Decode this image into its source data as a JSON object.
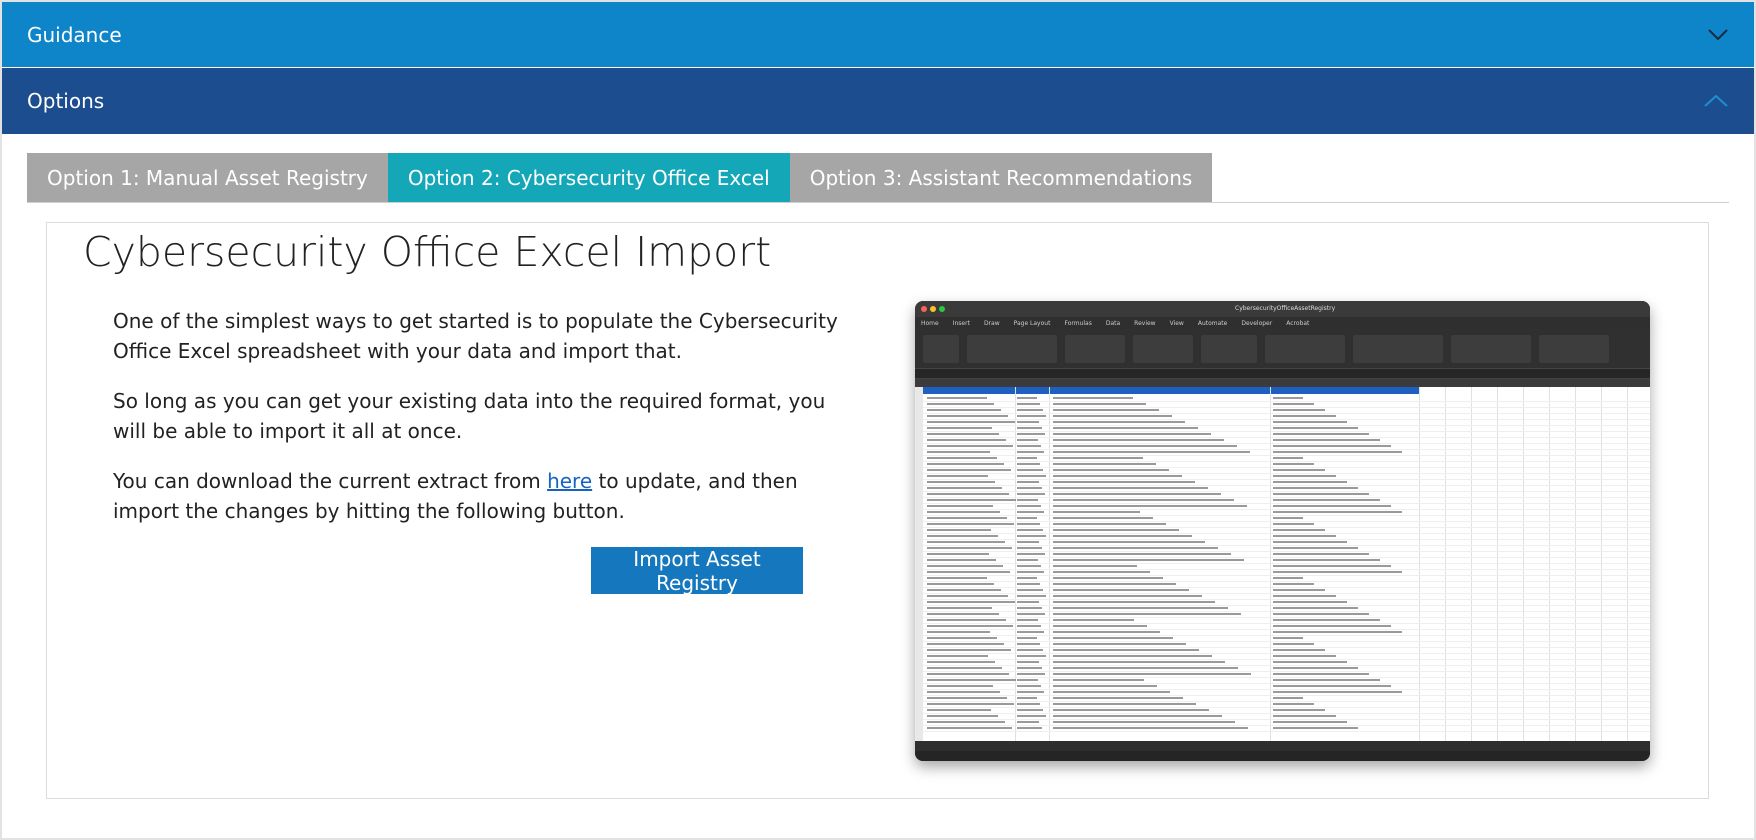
{
  "accordion": {
    "guidance_label": "Guidance",
    "options_label": "Options"
  },
  "tabs": [
    {
      "label": "Option 1: Manual Asset Registry",
      "active": false
    },
    {
      "label": "Option 2: Cybersecurity Office Excel",
      "active": true
    },
    {
      "label": "Option 3: Assistant Recommendations",
      "active": false
    }
  ],
  "content": {
    "heading": "Cybersecurity Office Excel Import",
    "para1": "One of the simplest ways to get started is to populate the Cybersecurity Office Excel spreadsheet with your data and import that.",
    "para2": "So long as you can get your existing data into the required format, you will be able to import it all at once.",
    "para3_before": "You can download the current extract from ",
    "para3_link": "here",
    "para3_after": " to update, and then import the changes by hitting the following button.",
    "import_button": "Import Asset Registry"
  },
  "excel_preview": {
    "window_title": "CybersecurityOfficeAssetRegistry",
    "menu": [
      "Home",
      "Insert",
      "Draw",
      "Page Layout",
      "Formulas",
      "Data",
      "Review",
      "View",
      "Automate",
      "Developer",
      "Acrobat"
    ]
  },
  "colors": {
    "guidance_bar": "#0d85c8",
    "options_bar": "#1c4d8f",
    "tab_inactive": "#a6a6a6",
    "tab_active": "#14a7b7",
    "button": "#1577bd",
    "link": "#1565c0"
  },
  "icons": {
    "guidance_toggle": "chevron-down-icon",
    "options_toggle": "chevron-up-icon"
  }
}
